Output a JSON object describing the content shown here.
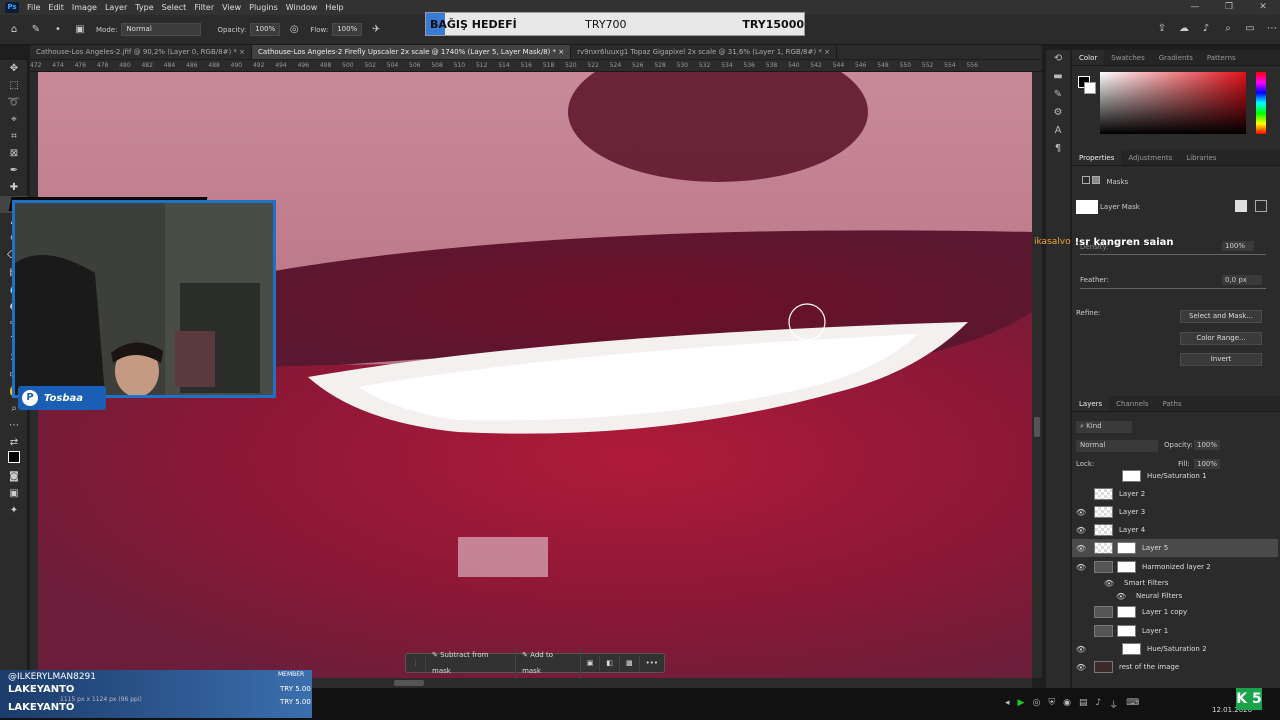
{
  "menubar": {
    "app_icon": "Ps",
    "items": [
      "File",
      "Edit",
      "Image",
      "Layer",
      "Type",
      "Select",
      "Filter",
      "View",
      "Plugins",
      "Window",
      "Help"
    ]
  },
  "window_controls": [
    "—",
    "❐",
    "✕"
  ],
  "options": {
    "mode_label": "Mode:",
    "mode_value": "Normal",
    "opacity_label": "Opacity:",
    "opacity_value": "100%",
    "flow_label": "Flow:",
    "flow_value": "100%"
  },
  "donation": {
    "label": "BAĞIŞ HEDEFİ",
    "current": "TRY700",
    "goal": "TRY15000",
    "progress": 0.05
  },
  "tabs": [
    {
      "label": "Cathouse-Los Angeles-2.jfif @ 90,2% (Layer 0, RGB/8#) *",
      "close": "×"
    },
    {
      "label": "Cathouse-Los Angeles-2 Firefly Upscaler 2x scale @ 1740% (Layer 5, Layer Mask/8) *",
      "close": "×"
    },
    {
      "label": "rv9nxr6luuxg1 Topaz Gigapixel 2x scale @ 31,6% (Layer 1, RGB/8#) *",
      "close": "×"
    }
  ],
  "ruler": [
    "472",
    "474",
    "476",
    "478",
    "480",
    "482",
    "484",
    "486",
    "488",
    "490",
    "492",
    "494",
    "496",
    "498",
    "500",
    "502",
    "504",
    "506",
    "508",
    "510",
    "512",
    "514",
    "516",
    "518",
    "520",
    "522",
    "524",
    "526",
    "528",
    "530",
    "532",
    "534",
    "536",
    "538",
    "540",
    "542",
    "544",
    "546",
    "548",
    "550",
    "552",
    "554",
    "556"
  ],
  "color_panel": {
    "tabs": [
      "Color",
      "Swatches",
      "Gradients",
      "Patterns"
    ]
  },
  "properties": {
    "tabs": [
      "Properties",
      "Adjustments",
      "Libraries"
    ],
    "masks_label": "Masks",
    "layer_mask_label": "Layer Mask",
    "density_label": "Density:",
    "density_value": "100%",
    "feather_label": "Feather:",
    "feather_value": "0,0 px",
    "refine_label": "Refine:",
    "select_mask": "Select and Mask...",
    "color_range": "Color Range...",
    "invert": "Invert"
  },
  "layers": {
    "tabs": [
      "Layers",
      "Channels",
      "Paths"
    ],
    "kind": "Kind",
    "blend": "Normal",
    "opacity_label": "Opacity:",
    "opacity_value": "100%",
    "lock_label": "Lock:",
    "fill_label": "Fill:",
    "fill_value": "100%",
    "rows": [
      {
        "name": "Hue/Saturation 1"
      },
      {
        "name": "Layer 2"
      },
      {
        "name": "Layer 3"
      },
      {
        "name": "Layer 4"
      },
      {
        "name": "Layer 5"
      },
      {
        "name": "Harmonized layer 2"
      },
      {
        "name": "Smart Filters"
      },
      {
        "name": "Neural Filters"
      },
      {
        "name": "Layer 1 copy"
      },
      {
        "name": "Layer 1"
      },
      {
        "name": "Hue/Saturation 2"
      },
      {
        "name": "rest of the image"
      }
    ]
  },
  "chat": {
    "user": "ikasalvo",
    "message": "!sr kangren saian"
  },
  "stream": {
    "brand": "Tosbaa",
    "member_badge": "MEMBER",
    "handle": "@ILKERYLMAN8291",
    "name1": "LAKEYANTO",
    "amount1": "TRY 5.00",
    "name2": "LAKEYANTO",
    "amount2": "TRY 5.00",
    "status_text": "1115 px x 1124 px (96 ppi)"
  },
  "context_bar": {
    "subtract": "Subtract from mask",
    "add": "Add to mask",
    "more": "•••"
  },
  "taskbar": {
    "date": "12.01.2026",
    "logo_text": "5"
  },
  "colors": {
    "accent": "#31a8ff",
    "stream_blue": "#1e70c8",
    "chat_user": "#f0a030"
  }
}
